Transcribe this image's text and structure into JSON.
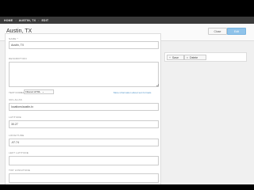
{
  "breadcrumb": {
    "items": [
      "HOME",
      "AUSTIN, TX",
      "EDIT"
    ]
  },
  "header": {
    "title": "Austin, TX",
    "close_label": "Close",
    "edit_label": "Edit"
  },
  "form": {
    "name": {
      "label": "NAME *",
      "value": "Austin, TX"
    },
    "description": {
      "label": "DESCRIPTION",
      "value": ""
    },
    "text_format": {
      "label": "TEXT FORMAT",
      "selected": "Filtered HTML",
      "link": "More information about text formats"
    },
    "url_alias": {
      "label": "URL ALIAS",
      "value": "locations/austin-tx"
    },
    "latitude": {
      "label": "LATITUDE",
      "value": "30.27"
    },
    "longitude": {
      "label": "LONGITUDE",
      "value": "-97.74"
    },
    "left_latitude": {
      "label": "LEFT LATITUDE",
      "value": ""
    },
    "top_longitude": {
      "label": "TOP LONGITUDE",
      "value": ""
    }
  },
  "actions": {
    "save_label": "Save",
    "delete_label": "Delete"
  }
}
